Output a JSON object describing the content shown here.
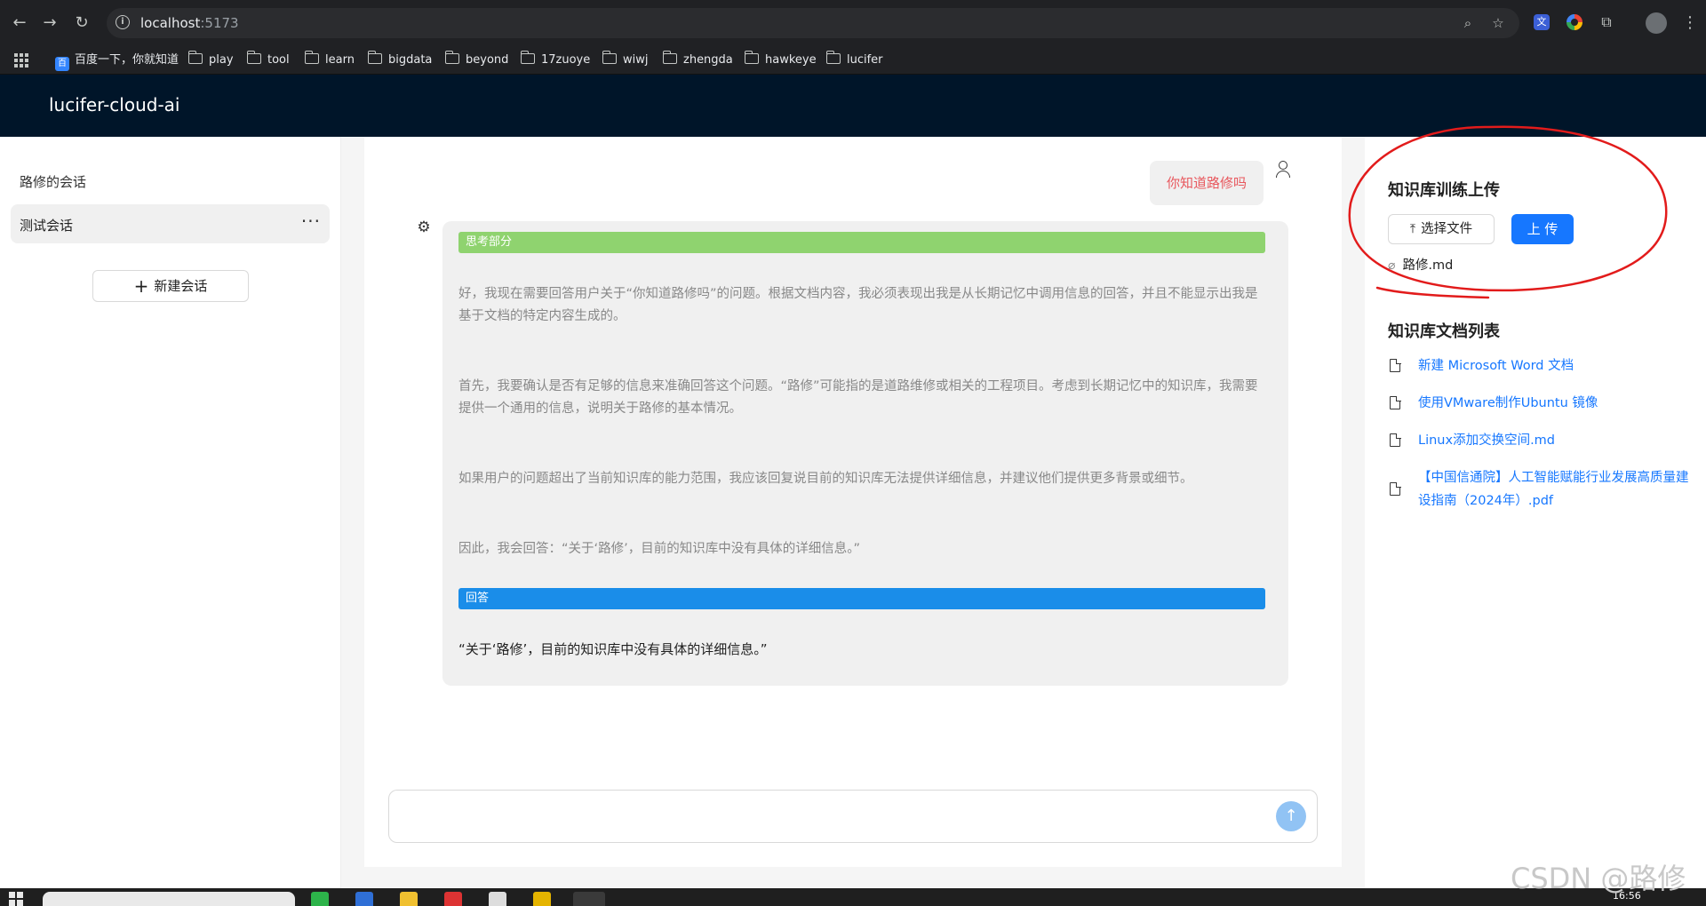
{
  "browser": {
    "url_host": "localhost",
    "url_port": ":5173",
    "bookmarks": [
      {
        "label": "百度一下，你就知道",
        "icon": "baidu-icon"
      },
      {
        "label": "play",
        "icon": "folder-icon"
      },
      {
        "label": "tool",
        "icon": "folder-icon"
      },
      {
        "label": "learn",
        "icon": "folder-icon"
      },
      {
        "label": "bigdata",
        "icon": "folder-icon"
      },
      {
        "label": "beyond",
        "icon": "folder-icon"
      },
      {
        "label": "17zuoye",
        "icon": "folder-icon"
      },
      {
        "label": "wiwj",
        "icon": "folder-icon"
      },
      {
        "label": "zhengda",
        "icon": "folder-icon"
      },
      {
        "label": "hawkeye",
        "icon": "folder-icon"
      },
      {
        "label": "lucifer",
        "icon": "folder-icon"
      }
    ]
  },
  "app": {
    "title": "lucifer-cloud-ai",
    "header_bg": "#001529"
  },
  "sidebar": {
    "title": "路修的会话",
    "conversations": [
      {
        "label": "测试会话",
        "more": "···"
      }
    ],
    "new_conversation_label": "新建会话"
  },
  "chat": {
    "user_message": "你知道路修吗",
    "thinking_label": "思考部分",
    "thinking_paragraphs": [
      "好，我现在需要回答用户关于“你知道路修吗”的问题。根据文档内容，我必须表现出我是从长期记忆中调用信息的回答，并且不能显示出我是基于文档的特定内容生成的。",
      "首先，我要确认是否有足够的信息来准确回答这个问题。“路修”可能指的是道路维修或相关的工程项目。考虑到长期记忆中的知识库，我需要提供一个通用的信息，说明关于路修的基本情况。",
      "如果用户的问题超出了当前知识库的能力范围，我应该回复说目前的知识库无法提供详细信息，并建议他们提供更多背景或细节。",
      "因此，我会回答：“关于‘路修’，目前的知识库中没有具体的详细信息。”"
    ],
    "answer_label": "回答",
    "answer_text": "“关于‘路修’，目前的知识库中没有具体的详细信息。”",
    "input_value": "",
    "thinking_color": "#8fd36f",
    "answer_color": "#1a8de9",
    "user_text_color": "#e8575d"
  },
  "knowledge": {
    "upload_title": "知识库训练上传",
    "choose_file_label": "选择文件",
    "upload_label": "上 传",
    "selected_file": "路修.md",
    "list_title": "知识库文档列表",
    "documents": [
      "新建 Microsoft Word 文档",
      "使用VMware制作Ubuntu 镜像",
      "Linux添加交换空间.md",
      "【中国信通院】人工智能赋能行业发展高质量建设指南（2024年）.pdf"
    ],
    "accent": "#1677ff"
  },
  "taskbar": {
    "clock": "16:56"
  },
  "watermark": "CSDN @路修"
}
